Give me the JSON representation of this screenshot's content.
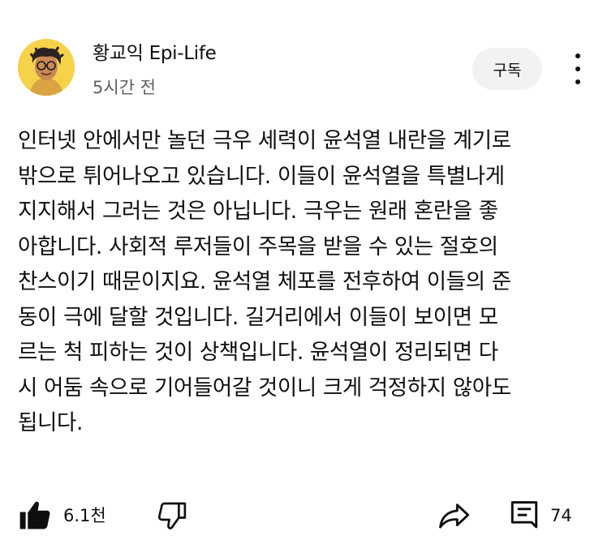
{
  "comment": {
    "author": "황교익 Epi-Life",
    "time": "5시간 전",
    "subscribe_label": "구독",
    "lines": [
      "인터넷 안에서만 놀던 극우 세력이 윤석열 내란을 계기로",
      "밖으로 튀어나오고 있습니다. 이들이 윤석열을 특별나게",
      "지지해서 그러는 것은 아닙니다. 극우는 원래 혼란을 좋",
      "아합니다. 사회적 루저들이 주목을 받을 수 있는 절호의",
      "찬스이기 때문이지요. 윤석열 체포를 전후하여 이들의 준",
      "동이 극에 달할 것입니다. 길거리에서 이들이 보이면 모",
      "르는 척 피하는 것이 상책입니다. 윤석열이 정리되면 다",
      "시 어둠 속으로 기어들어갈 것이니 크게 걱정하지 않아도",
      "됩니다."
    ]
  },
  "actions": {
    "like_count": "6.1천",
    "reply_count": "74"
  },
  "icons": {
    "like": "thumbs-up-filled-icon",
    "dislike": "thumbs-down-outline-icon",
    "share": "share-arrow-icon",
    "reply": "comment-icon",
    "more": "more-vertical-icon"
  }
}
